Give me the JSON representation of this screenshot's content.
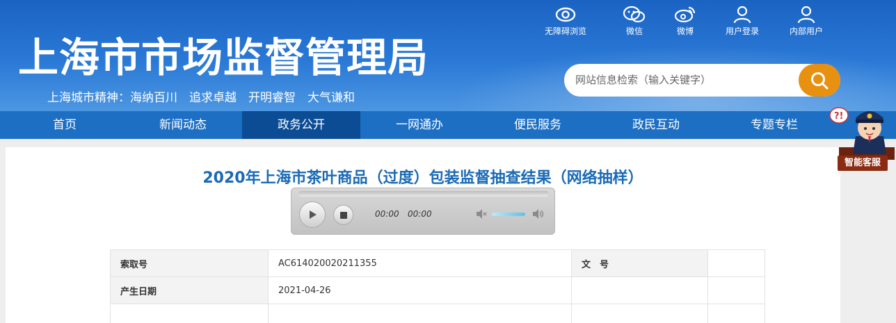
{
  "header": {
    "site_title": "上海市市场监督管理局",
    "slogan": "上海城市精神：海纳百川　追求卓越　开明睿智　大气谦和",
    "top_links": [
      {
        "label": "无障碍浏览",
        "icon": "eye-icon"
      },
      {
        "label": "微信",
        "icon": "wechat-icon"
      },
      {
        "label": "微博",
        "icon": "weibo-icon"
      },
      {
        "label": "用户登录",
        "icon": "user-icon"
      },
      {
        "label": "内部用户",
        "icon": "user-icon"
      }
    ],
    "search": {
      "placeholder": "网站信息检索（输入关键字）",
      "button_icon": "search-icon",
      "button_color": "#e8900f"
    }
  },
  "nav": {
    "items": [
      "首页",
      "新闻动态",
      "政务公开",
      "一网通办",
      "便民服务",
      "政民互动",
      "专题专栏"
    ],
    "active": "政务公开"
  },
  "article": {
    "title": "2020年上海市茶叶商品（过度）包装监督抽查结果（网络抽样）"
  },
  "player": {
    "current_time": "00:00",
    "duration": "00:00",
    "play_icon": "play-icon",
    "stop_icon": "stop-icon"
  },
  "meta": {
    "index_label": "索取号",
    "index_value": "AC614020020211355",
    "doc_no_label": "文　号",
    "doc_no_value": "",
    "date_label": "产生日期",
    "date_value": "2021-04-26"
  },
  "assistant": {
    "label": "智能客服"
  },
  "colors": {
    "header_blue": "#1b63c3",
    "nav_blue": "#1d6fc4",
    "nav_active": "#0c4c94",
    "title_blue": "#1a6ab5",
    "accent_orange": "#e8900f"
  }
}
